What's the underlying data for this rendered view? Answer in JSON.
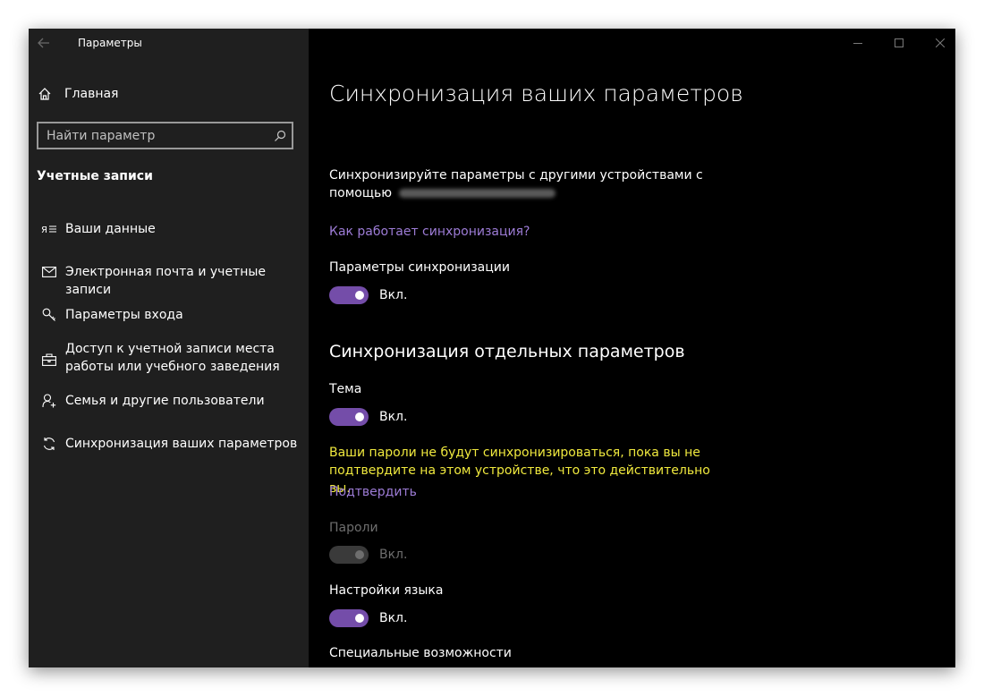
{
  "window": {
    "app_title": "Параметры"
  },
  "sidebar": {
    "home_label": "Главная",
    "search": {
      "placeholder": "Найти параметр"
    },
    "section_heading": "Учетные записи",
    "items": [
      {
        "label": "Ваши данные",
        "icon": "person-card-icon"
      },
      {
        "label": "Электронная почта и учетные записи",
        "icon": "mail-icon"
      },
      {
        "label": "Параметры входа",
        "icon": "key-icon"
      },
      {
        "label": "Доступ к учетной записи места работы или учебного заведения",
        "icon": "briefcase-icon"
      },
      {
        "label": "Семья и другие пользователи",
        "icon": "add-person-icon"
      },
      {
        "label": "Синхронизация ваших параметров",
        "icon": "sync-icon"
      }
    ]
  },
  "main": {
    "title": "Синхронизация ваших параметров",
    "description": "Синхронизируйте параметры с другими устройствами с помощью",
    "how_sync_link": "Как работает синхронизация?",
    "sync_settings": {
      "label": "Параметры синхронизации",
      "state": "Вкл.",
      "on": true
    },
    "individual_title": "Синхронизация отдельных параметров",
    "theme": {
      "label": "Тема",
      "state": "Вкл.",
      "on": true
    },
    "warning": "Ваши пароли не будут синхронизироваться, пока вы не подтвердите на этом устройстве, что это действительно вы.",
    "confirm_link": "Подтвердить",
    "passwords": {
      "label": "Пароли",
      "state": "Вкл.",
      "on": true,
      "disabled": true
    },
    "language": {
      "label": "Настройки языка",
      "state": "Вкл.",
      "on": true
    },
    "accessibility": {
      "label": "Специальные возможности"
    }
  },
  "colors": {
    "accent": "#744da9",
    "link": "#9d7cd6",
    "warning": "#f0e93e",
    "sidebar_bg": "#1f1f1f",
    "content_bg": "#000000"
  }
}
